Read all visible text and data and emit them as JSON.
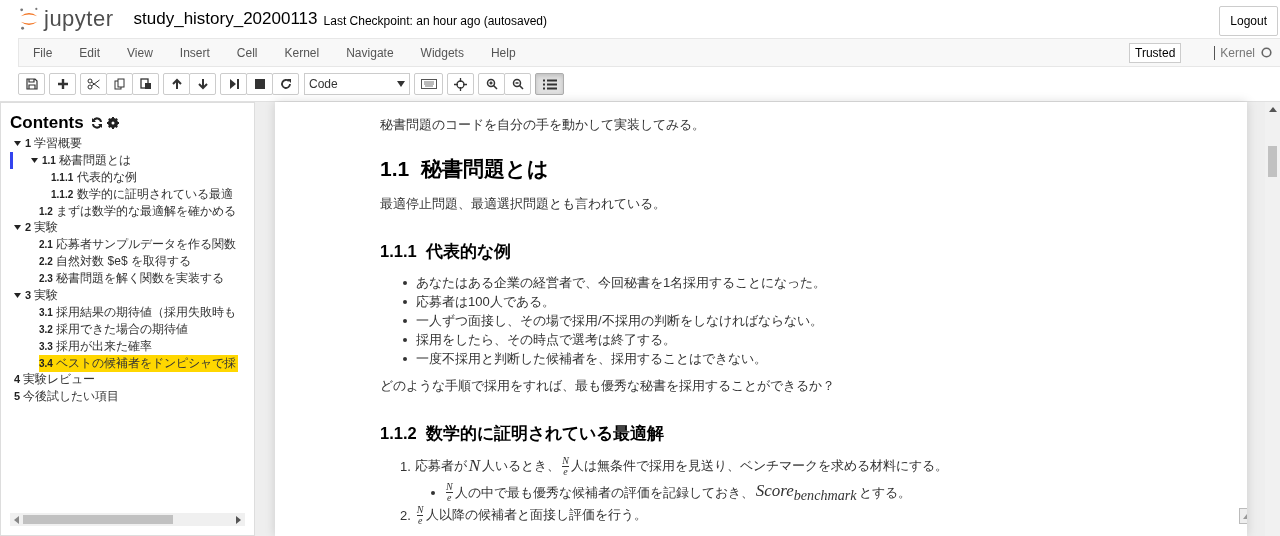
{
  "header": {
    "logo": "jupyter",
    "notebook_name": "study_history_20200113",
    "checkpoint": "Last Checkpoint: an hour ago (autosaved)",
    "logout": "Logout"
  },
  "menu": {
    "items": [
      "File",
      "Edit",
      "View",
      "Insert",
      "Cell",
      "Kernel",
      "Navigate",
      "Widgets",
      "Help"
    ],
    "trusted": "Trusted",
    "kernel": "Kernel"
  },
  "toolbar": {
    "cell_type": "Code",
    "toc_toggle": {
      "selected": true
    }
  },
  "toc": {
    "title": "Contents",
    "items": [
      {
        "number": "1",
        "title": "学習概要",
        "expanded": true,
        "selected": false,
        "current": false,
        "children": [
          {
            "number": "1.1",
            "title": "秘書問題とは",
            "expanded": true,
            "selected": false,
            "current": true,
            "children": [
              {
                "number": "1.1.1",
                "title": "代表的な例",
                "selected": false,
                "current": false
              },
              {
                "number": "1.1.2",
                "title": "数学的に証明されている最適",
                "selected": false,
                "current": false
              }
            ]
          },
          {
            "number": "1.2",
            "title": "まずは数学的な最適解を確かめる",
            "selected": false,
            "current": false
          }
        ]
      },
      {
        "number": "2",
        "title": "実験",
        "expanded": true,
        "selected": false,
        "current": false,
        "children": [
          {
            "number": "2.1",
            "title": "応募者サンプルデータを作る関数",
            "selected": false,
            "current": false
          },
          {
            "number": "2.2",
            "title": "自然対数 $e$ を取得する",
            "selected": false,
            "current": false
          },
          {
            "number": "2.3",
            "title": "秘書問題を解く関数を実装する",
            "selected": false,
            "current": false
          }
        ]
      },
      {
        "number": "3",
        "title": "実験",
        "expanded": true,
        "selected": false,
        "current": false,
        "children": [
          {
            "number": "3.1",
            "title": "採用結果の期待値（採用失敗時も",
            "selected": false,
            "current": false
          },
          {
            "number": "3.2",
            "title": "採用できた場合の期待値",
            "selected": false,
            "current": false
          },
          {
            "number": "3.3",
            "title": "採用が出来た確率",
            "selected": false,
            "current": false
          },
          {
            "number": "3.4",
            "title": "ベストの候補者をドンピシャで採",
            "selected": true,
            "current": false
          }
        ]
      },
      {
        "number": "4",
        "title": "実験レビュー",
        "selected": false,
        "current": false
      },
      {
        "number": "5",
        "title": "今後試したい項目",
        "selected": false,
        "current": false
      }
    ]
  },
  "notebook": {
    "blocks": [
      {
        "kind": "para",
        "text": "秘書問題のコードを自分の手を動かして実装してみる。"
      },
      {
        "kind": "h2",
        "number": "1.1",
        "text": "秘書問題とは"
      },
      {
        "kind": "para",
        "text": "最適停止問題、最適選択問題とも言われている。"
      },
      {
        "kind": "h3",
        "number": "1.1.1",
        "text": "代表的な例"
      },
      {
        "kind": "ul",
        "items": [
          {
            "parts": [
              {
                "kind": "text",
                "text": "あなたはある企業の経営者で、今回秘書を1名採用することになった。"
              }
            ]
          },
          {
            "parts": [
              {
                "kind": "text",
                "text": "応募者は100人である。"
              }
            ]
          },
          {
            "parts": [
              {
                "kind": "text",
                "text": "一人ずつ面接し、その場で採用/不採用の判断をしなければならない。"
              }
            ]
          },
          {
            "parts": [
              {
                "kind": "text",
                "text": "採用をしたら、その時点で選考は終了する。"
              }
            ]
          },
          {
            "parts": [
              {
                "kind": "text",
                "text": "一度不採用と判断した候補者を、採用することはできない。"
              }
            ]
          }
        ]
      },
      {
        "kind": "para",
        "text": "どのような手順で採用をすれば、最も優秀な秘書を採用することができるか？"
      },
      {
        "kind": "h3",
        "number": "1.1.2",
        "text": "数学的に証明されている最適解"
      },
      {
        "kind": "ol",
        "items": [
          {
            "marker": "1.",
            "parts": [
              {
                "kind": "text",
                "text": "応募者が "
              },
              {
                "kind": "math",
                "text": "N"
              },
              {
                "kind": "text",
                "text": "人いるとき、"
              },
              {
                "kind": "frac",
                "num": "N",
                "den": "e"
              },
              {
                "kind": "text",
                "text": "人は無条件で採用を見送り、ベンチマークを求める材料にする。"
              }
            ],
            "sub": [
              {
                "parts": [
                  {
                    "kind": "frac",
                    "num": "N",
                    "den": "e"
                  },
                  {
                    "kind": "text",
                    "text": "人の中で最も優秀な候補者の評価を記録しておき、"
                  },
                  {
                    "kind": "math",
                    "text": "Score$_{benchmark}$"
                  },
                  {
                    "kind": "text",
                    "text": " とする。"
                  }
                ]
              }
            ]
          },
          {
            "marker": "2.",
            "parts": [
              {
                "kind": "frac",
                "num": "N",
                "den": "e"
              },
              {
                "kind": "text",
                "text": "人以降の候補者と面接し評価を行う。"
              }
            ]
          }
        ]
      }
    ]
  }
}
